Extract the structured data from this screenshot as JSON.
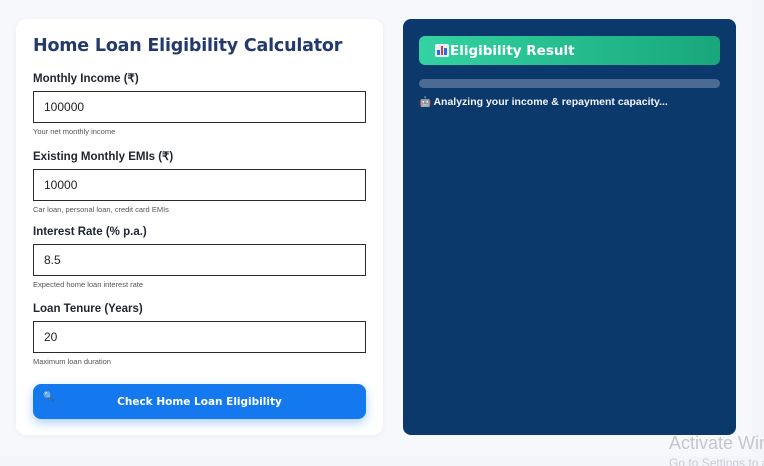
{
  "calculator": {
    "title": "Home Loan Eligibility Calculator",
    "fields": [
      {
        "label": "Monthly Income (₹)",
        "value": "100000",
        "help": "Your net monthly income"
      },
      {
        "label": "Existing Monthly EMIs (₹)",
        "value": "10000",
        "help": "Car loan, personal loan, credit card EMIs"
      },
      {
        "label": "Interest Rate (% p.a.)",
        "value": "8.5",
        "help": "Expected home loan interest rate"
      },
      {
        "label": "Loan Tenure (Years)",
        "value": "20",
        "help": "Maximum loan duration"
      }
    ],
    "button_label": "Check Home Loan Eligibility",
    "button_icon": "magnifier-icon"
  },
  "result": {
    "title": "Eligibility Result",
    "title_icon": "bar-chart-icon",
    "progress": 0,
    "status": "Analyzing your income & repayment capacity...",
    "status_icon": "robot-icon"
  },
  "watermark": {
    "line1": "Activate Windows",
    "line2": "Go to Settings to activate Windows."
  },
  "colors": {
    "title": "#233a6b",
    "button": "#1479ee",
    "result_panel": "#0b396b",
    "result_header_start": "#34d2a2",
    "result_header_end": "#18a77a"
  }
}
